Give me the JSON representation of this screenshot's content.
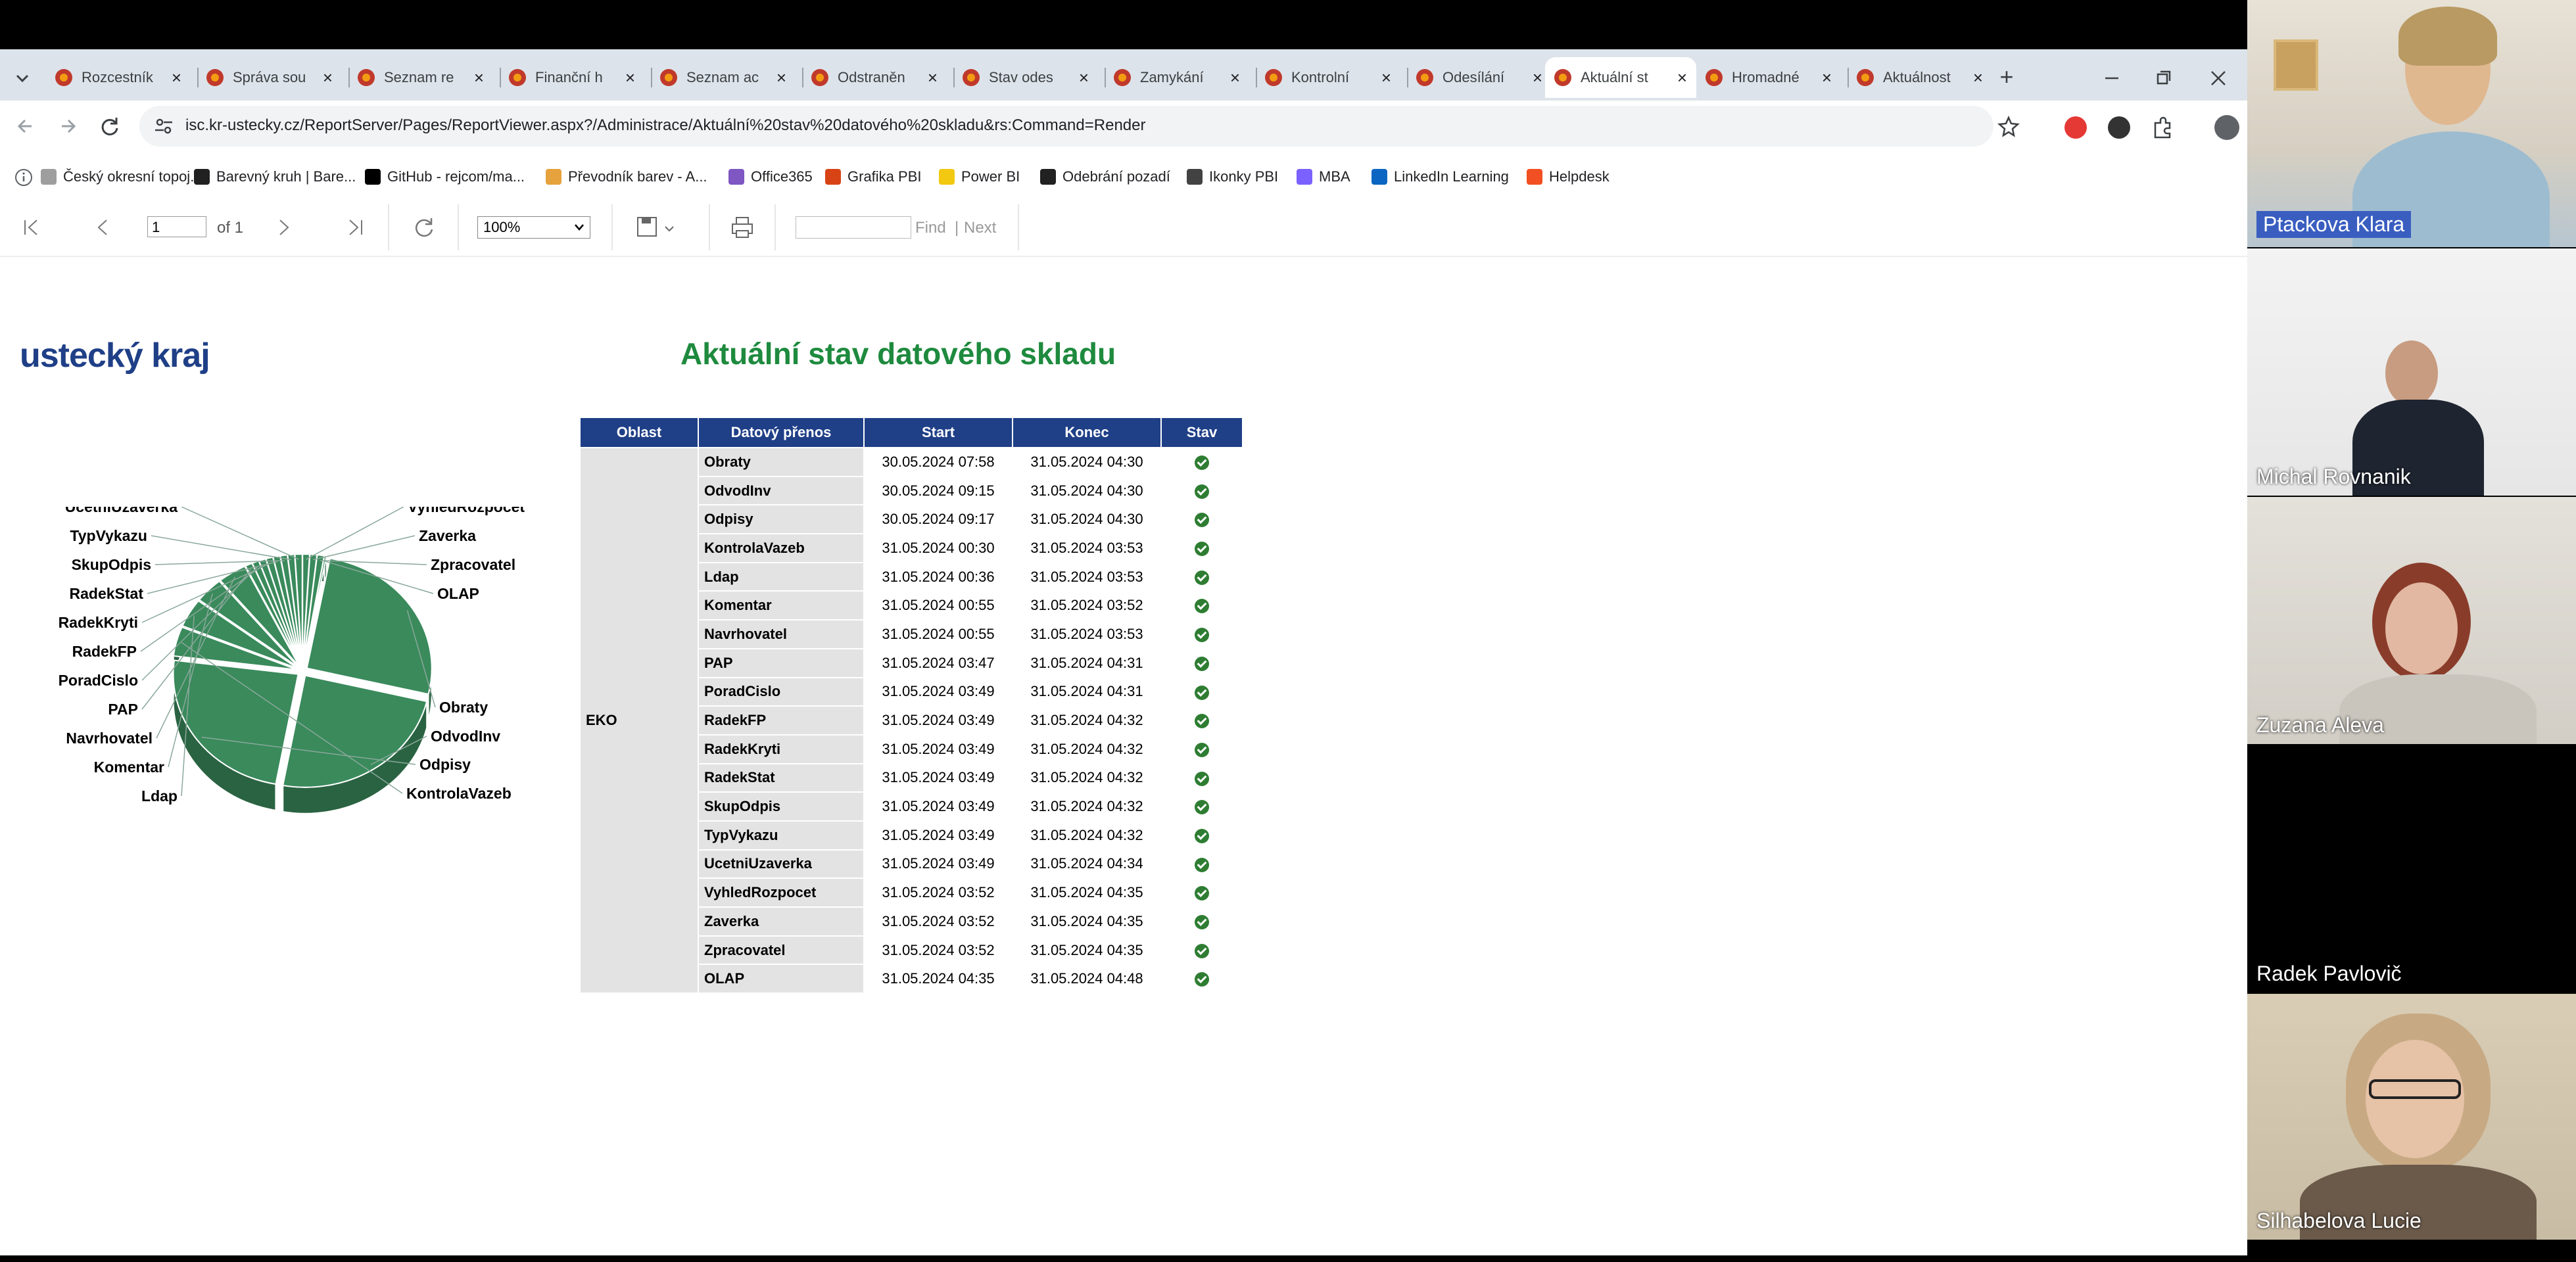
{
  "browser": {
    "tabs": [
      {
        "title": "Rozcestník"
      },
      {
        "title": "Správa sou"
      },
      {
        "title": "Seznam re"
      },
      {
        "title": "Finanční h"
      },
      {
        "title": "Seznam ac"
      },
      {
        "title": "Odstraněn"
      },
      {
        "title": "Stav odes"
      },
      {
        "title": "Zamykání"
      },
      {
        "title": "Kontrolní"
      },
      {
        "title": "Odesílání"
      },
      {
        "title": "Aktuální st"
      },
      {
        "title": "Hromadné"
      },
      {
        "title": "Aktuálnost"
      }
    ],
    "active_tab": 10,
    "new_tab_symbol": "+",
    "url": "isc.kr-ustecky.cz/ReportServer/Pages/ReportViewer.aspx?/Administrace/Aktuální%20stav%20datového%20skladu&rs:Command=Render",
    "bookmarks": [
      {
        "label": "Český okresní topoj...",
        "color": "#9e9e9e"
      },
      {
        "label": "Barevný kruh | Bare...",
        "color": "#212121"
      },
      {
        "label": "GitHub - rejcom/ma...",
        "color": "#000000"
      },
      {
        "label": "Převodník barev - A...",
        "color": "#e6a23c"
      },
      {
        "label": "Office365",
        "color": "#7e57c2"
      },
      {
        "label": "Grafika PBI",
        "color": "#d84315"
      },
      {
        "label": "Power BI",
        "color": "#f2c811"
      },
      {
        "label": "Odebrání pozadí",
        "color": "#212121"
      },
      {
        "label": "Ikonky PBI",
        "color": "#424242"
      },
      {
        "label": "MBA",
        "color": "#7b61ff"
      },
      {
        "label": "LinkedIn Learning",
        "color": "#0a66c2"
      },
      {
        "label": "Helpdesk",
        "color": "#f25022"
      }
    ]
  },
  "report_toolbar": {
    "page_value": "1",
    "page_of": "of 1",
    "zoom": "100%",
    "find_label": "Find",
    "separator": "|",
    "next_label": "Next"
  },
  "report": {
    "logo": "ustecký kraj",
    "title": "Aktuální stav datového skladu",
    "columns": [
      "Oblast",
      "Datový přenos",
      "Start",
      "Konec",
      "Stav"
    ],
    "area": "EKO",
    "rows": [
      {
        "name": "Obraty",
        "start": "30.05.2024 07:58",
        "end": "31.05.2024 04:30",
        "ok": true
      },
      {
        "name": "OdvodInv",
        "start": "30.05.2024 09:15",
        "end": "31.05.2024 04:30",
        "ok": true
      },
      {
        "name": "Odpisy",
        "start": "30.05.2024 09:17",
        "end": "31.05.2024 04:30",
        "ok": true
      },
      {
        "name": "KontrolaVazeb",
        "start": "31.05.2024 00:30",
        "end": "31.05.2024 03:53",
        "ok": true
      },
      {
        "name": "Ldap",
        "start": "31.05.2024 00:36",
        "end": "31.05.2024 03:53",
        "ok": true
      },
      {
        "name": "Komentar",
        "start": "31.05.2024 00:55",
        "end": "31.05.2024 03:52",
        "ok": true
      },
      {
        "name": "Navrhovatel",
        "start": "31.05.2024 00:55",
        "end": "31.05.2024 03:53",
        "ok": true
      },
      {
        "name": "PAP",
        "start": "31.05.2024 03:47",
        "end": "31.05.2024 04:31",
        "ok": true
      },
      {
        "name": "PoradCislo",
        "start": "31.05.2024 03:49",
        "end": "31.05.2024 04:31",
        "ok": true
      },
      {
        "name": "RadekFP",
        "start": "31.05.2024 03:49",
        "end": "31.05.2024 04:32",
        "ok": true
      },
      {
        "name": "RadekKryti",
        "start": "31.05.2024 03:49",
        "end": "31.05.2024 04:32",
        "ok": true
      },
      {
        "name": "RadekStat",
        "start": "31.05.2024 03:49",
        "end": "31.05.2024 04:32",
        "ok": true
      },
      {
        "name": "SkupOdpis",
        "start": "31.05.2024 03:49",
        "end": "31.05.2024 04:32",
        "ok": true
      },
      {
        "name": "TypVykazu",
        "start": "31.05.2024 03:49",
        "end": "31.05.2024 04:32",
        "ok": true
      },
      {
        "name": "UcetniUzaverka",
        "start": "31.05.2024 03:49",
        "end": "31.05.2024 04:34",
        "ok": true
      },
      {
        "name": "VyhledRozpocet",
        "start": "31.05.2024 03:52",
        "end": "31.05.2024 04:35",
        "ok": true
      },
      {
        "name": "Zaverka",
        "start": "31.05.2024 03:52",
        "end": "31.05.2024 04:35",
        "ok": true
      },
      {
        "name": "Zpracovatel",
        "start": "31.05.2024 03:52",
        "end": "31.05.2024 04:35",
        "ok": true
      },
      {
        "name": "OLAP",
        "start": "31.05.2024 04:35",
        "end": "31.05.2024 04:48",
        "ok": true
      }
    ],
    "status_color": "#2e7d32",
    "header_color": "#1f3f87"
  },
  "chart_data": {
    "type": "pie",
    "title": "",
    "color": "#3a8a5c",
    "categories": [
      "VyhledRozpocet",
      "Zaverka",
      "Zpracovatel",
      "OLAP",
      "Obraty",
      "OdvodInv",
      "Odpisy",
      "KontrolaVazeb",
      "Ldap",
      "Komentar",
      "Navrhovatel",
      "PAP",
      "PoradCislo",
      "RadekFP",
      "RadekKryti",
      "RadekStat",
      "SkupOdpis",
      "TypVykazu",
      "UcetniUzaverka"
    ],
    "values": [
      43,
      43,
      43,
      13,
      1232,
      1155,
      1153,
      203,
      197,
      177,
      178,
      44,
      42,
      43,
      43,
      43,
      43,
      43,
      45
    ]
  },
  "participants": [
    "Ptackova Klara",
    "Michal Rovnanik",
    "Zuzana Aleva",
    "Radek Pavlovič",
    "Silhabelova Lucie"
  ]
}
